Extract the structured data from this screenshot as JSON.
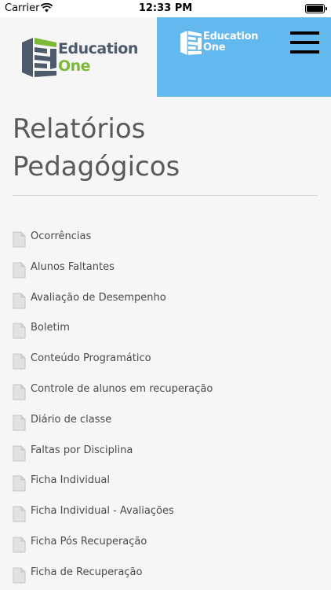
{
  "status_bar": {
    "carrier": "Carrier",
    "time": "12:33 PM"
  },
  "header": {
    "logo_line1": "Education",
    "logo_line2": "One",
    "logo_small_line1": "Education",
    "logo_small_line2": "One",
    "colors": {
      "header_right_bg": "#63b8ee",
      "logo_blue": "#4c5a6b",
      "logo_green": "#7db83a"
    }
  },
  "page": {
    "title_line1": "Relatórios",
    "title_line2": "Pedagógicos"
  },
  "reports": [
    {
      "label": "Ocorrências",
      "icon": "document-icon"
    },
    {
      "label": "Alunos Faltantes",
      "icon": "document-icon"
    },
    {
      "label": "Avaliação de Desempenho",
      "icon": "document-icon"
    },
    {
      "label": "Boletim",
      "icon": "document-icon"
    },
    {
      "label": "Conteúdo Programático",
      "icon": "document-icon"
    },
    {
      "label": "Controle de alunos em recuperação",
      "icon": "document-icon"
    },
    {
      "label": "Diário de classe",
      "icon": "document-icon"
    },
    {
      "label": "Faltas por Disciplina",
      "icon": "document-icon"
    },
    {
      "label": "Ficha Individual",
      "icon": "document-icon"
    },
    {
      "label": "Ficha Individual - Avaliações",
      "icon": "document-icon"
    },
    {
      "label": "Ficha Pós Recuperação",
      "icon": "document-icon"
    },
    {
      "label": "Ficha de Recuperação",
      "icon": "document-icon"
    }
  ]
}
